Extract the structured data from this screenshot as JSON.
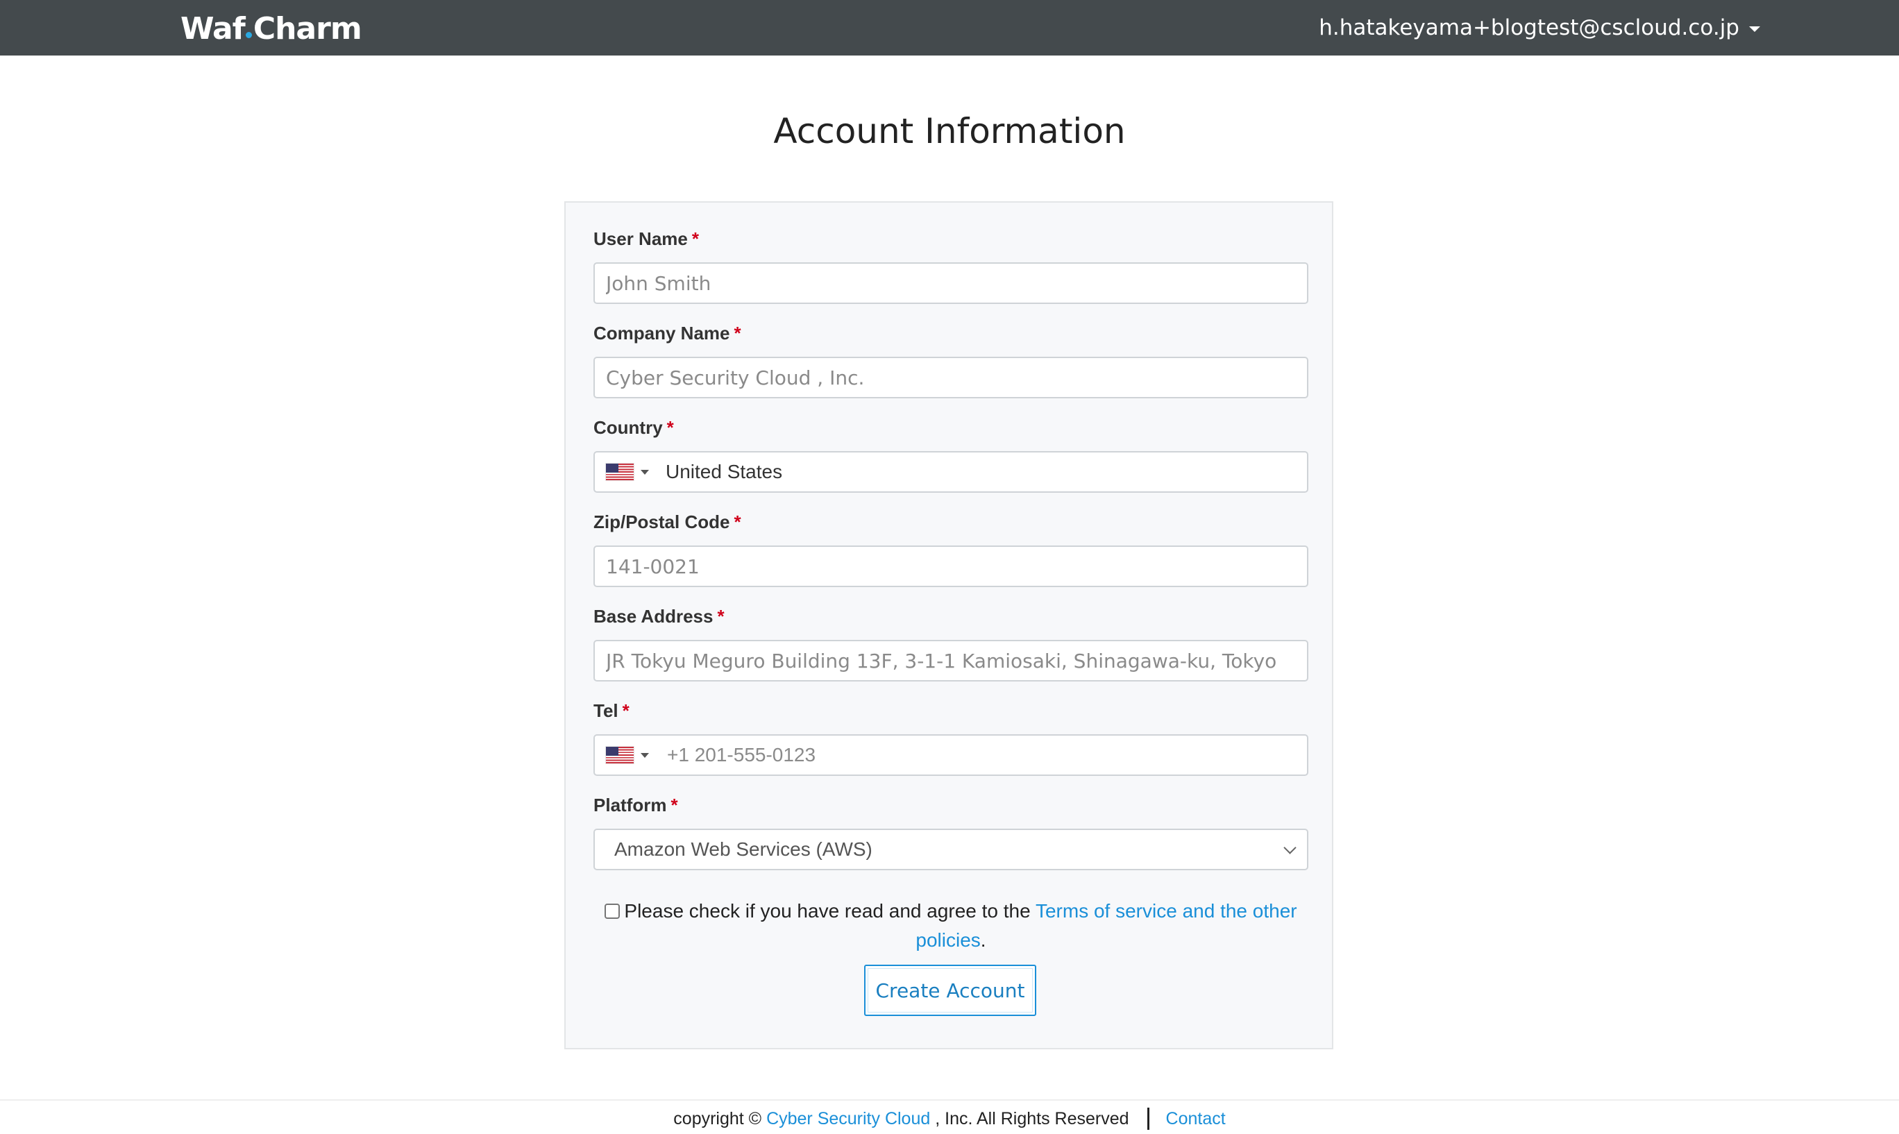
{
  "header": {
    "logo_left": "Waf",
    "logo_right": "Charm",
    "user_email": "h.hatakeyama+blogtest@cscloud.co.jp"
  },
  "page_title": "Account Information",
  "form": {
    "user_name": {
      "label": "User Name",
      "required_mark": "*",
      "placeholder": "John Smith"
    },
    "company_name": {
      "label": "Company Name",
      "required_mark": "*",
      "placeholder": "Cyber Security Cloud , Inc."
    },
    "country": {
      "label": "Country",
      "required_mark": "*",
      "value": "United States",
      "flag_icon": "us-flag-icon"
    },
    "zip": {
      "label": "Zip/Postal Code",
      "required_mark": "*",
      "placeholder": "141-0021"
    },
    "base_address": {
      "label": "Base Address",
      "required_mark": "*",
      "placeholder": "JR Tokyu Meguro Building 13F, 3-1-1 Kamiosaki, Shinagawa-ku, Tokyo"
    },
    "tel": {
      "label": "Tel",
      "required_mark": "*",
      "placeholder": "+1 201-555-0123",
      "flag_icon": "us-flag-icon"
    },
    "platform": {
      "label": "Platform",
      "required_mark": "*",
      "selected": "Amazon Web Services (AWS)"
    },
    "agreement": {
      "text": "Please check if you have read and agree to the",
      "link_text": "Terms of service and the other policies",
      "suffix": "."
    },
    "submit_label": "Create Account"
  },
  "footer": {
    "copyright_prefix": "copyright ©",
    "company_link": "Cyber Security Cloud",
    "copyright_suffix": ", Inc. All Rights Reserved",
    "contact_link": "Contact"
  },
  "colors": {
    "topbar": "#444a4d",
    "accent": "#1a8fd8",
    "required": "#d0021b",
    "card_bg": "#f7f8fa"
  }
}
